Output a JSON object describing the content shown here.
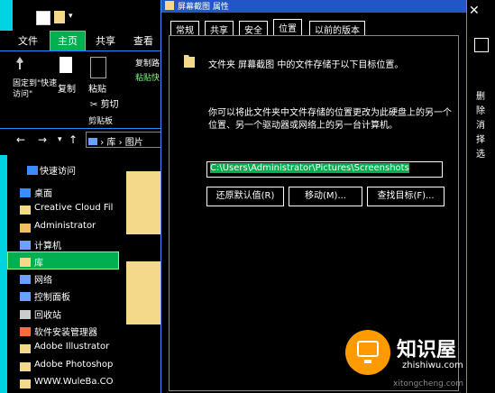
{
  "explorer": {
    "menu": [
      "文件",
      "主页",
      "共享",
      "查看"
    ],
    "active_menu_index": 1,
    "ribbon": {
      "pin_label": "固定到\"快速访问\"",
      "copy_label": "复制",
      "paste_label": "粘贴",
      "copy_path_label": "复制路",
      "paste_shortcut_label": "粘贴快",
      "cut_label": "剪切",
      "group_label": "剪贴板"
    },
    "address": {
      "seg1": "库",
      "seg2": "图片"
    },
    "nav": [
      {
        "label": "快速访问",
        "icon": "star-icon"
      },
      {
        "label": "桌面",
        "icon": "desktop-icon"
      },
      {
        "label": "Creative Cloud Fil",
        "icon": "folder-icon"
      },
      {
        "label": "Administrator",
        "icon": "user-icon"
      },
      {
        "label": "计算机",
        "icon": "computer-icon"
      },
      {
        "label": "库",
        "icon": "library-icon"
      },
      {
        "label": "网络",
        "icon": "network-icon"
      },
      {
        "label": "控制面板",
        "icon": "control-panel-icon"
      },
      {
        "label": "回收站",
        "icon": "recycle-bin-icon"
      },
      {
        "label": "软件安装管理器",
        "icon": "installer-icon"
      },
      {
        "label": "Adobe Illustrator",
        "icon": "folder-icon"
      },
      {
        "label": "Adobe Photoshop",
        "icon": "folder-icon"
      },
      {
        "label": "WWW.WuleBa.CO",
        "icon": "folder-icon"
      }
    ],
    "selected_nav_index": 5,
    "right_strip": [
      "删",
      "除",
      "消",
      "择",
      "选"
    ]
  },
  "dialog": {
    "title": "屏幕截图 属性",
    "tabs": [
      "常规",
      "共享",
      "安全",
      "位置",
      "以前的版本"
    ],
    "active_tab_index": 3,
    "description": "文件夹 屏幕截图 中的文件存储于以下目标位置。",
    "info_line1": "你可以将此文件夹中文件存储的位置更改为此硬盘上的另一个",
    "info_line2": "位置、另一个驱动器或网络上的另一台计算机。",
    "path_value": "C:\\Users\\Administrator\\Pictures\\Screenshots",
    "buttons": {
      "restore": "还原默认值(R)",
      "move": "移动(M)...",
      "find": "查找目标(F)..."
    }
  },
  "watermark": {
    "brand": "知识屋",
    "domain": "zhishiwu.com",
    "footer": "xitongcheng.com"
  },
  "colors": {
    "accent": "#00b050",
    "highlight": "#00d4e0",
    "dialog_title": "#2255c8"
  }
}
